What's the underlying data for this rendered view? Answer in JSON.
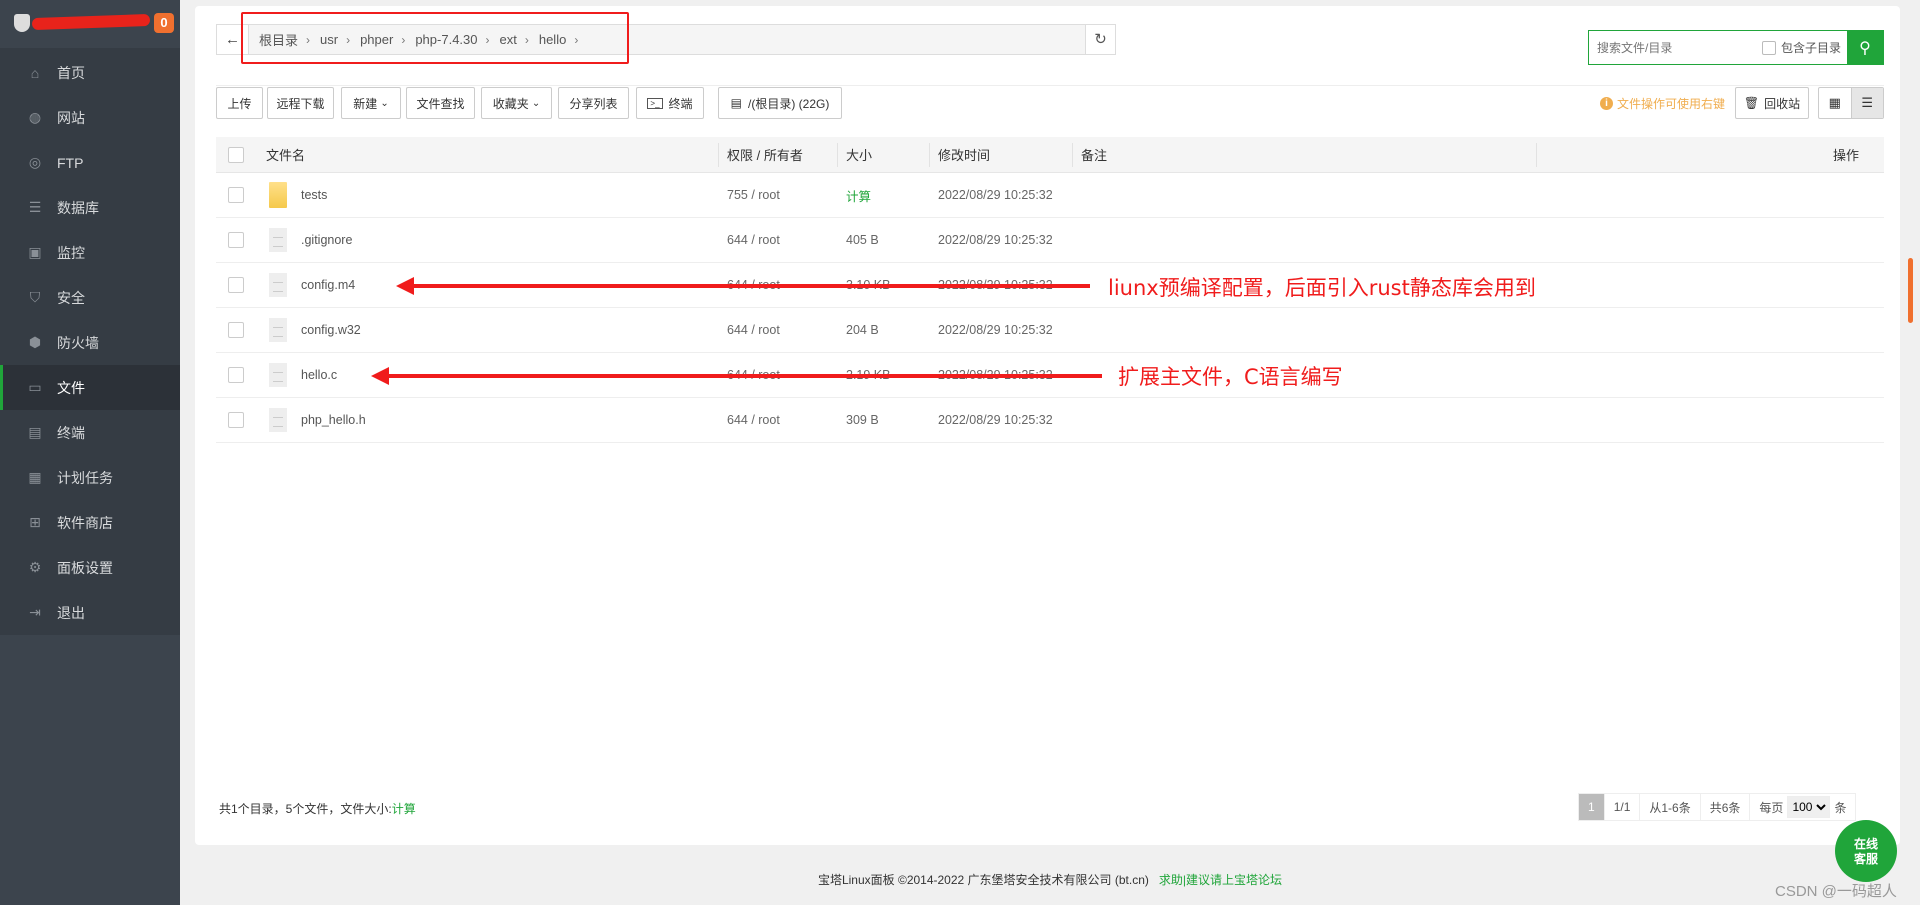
{
  "sidebar": {
    "badge": "0",
    "items": [
      {
        "label": "首页",
        "icon": "home-icon"
      },
      {
        "label": "网站",
        "icon": "globe-icon"
      },
      {
        "label": "FTP",
        "icon": "ftp-icon"
      },
      {
        "label": "数据库",
        "icon": "database-icon"
      },
      {
        "label": "监控",
        "icon": "monitor-icon"
      },
      {
        "label": "安全",
        "icon": "shield-icon"
      },
      {
        "label": "防火墙",
        "icon": "firewall-icon"
      },
      {
        "label": "文件",
        "icon": "folder-icon",
        "active": true
      },
      {
        "label": "终端",
        "icon": "terminal-icon"
      },
      {
        "label": "计划任务",
        "icon": "calendar-icon"
      },
      {
        "label": "软件商店",
        "icon": "apps-icon"
      },
      {
        "label": "面板设置",
        "icon": "gear-icon"
      },
      {
        "label": "退出",
        "icon": "logout-icon"
      }
    ]
  },
  "breadcrumb": [
    "根目录",
    "usr",
    "phper",
    "php-7.4.30",
    "ext",
    "hello"
  ],
  "search": {
    "placeholder": "搜索文件/目录",
    "subdir_label": "包含子目录"
  },
  "toolbar": {
    "upload": "上传",
    "remote_download": "远程下载",
    "new": "新建",
    "find": "文件查找",
    "favorites": "收藏夹",
    "share_list": "分享列表",
    "terminal": "终端",
    "disk": "/(根目录) (22G)",
    "tip": "文件操作可使用右键",
    "recycle": "回收站"
  },
  "table": {
    "headers": {
      "name": "文件名",
      "perm": "权限 / 所有者",
      "size": "大小",
      "mtime": "修改时间",
      "remark": "备注",
      "ops": "操作"
    },
    "rows": [
      {
        "name": "tests",
        "type": "folder",
        "perm": "755 / root",
        "size": "计算",
        "mtime": "2022/08/29 10:25:32"
      },
      {
        "name": ".gitignore",
        "type": "file",
        "perm": "644 / root",
        "size": "405 B",
        "mtime": "2022/08/29 10:25:32"
      },
      {
        "name": "config.m4",
        "type": "file",
        "perm": "644 / root",
        "size": "3.10 KB",
        "mtime": "2022/08/29 10:25:32"
      },
      {
        "name": "config.w32",
        "type": "file",
        "perm": "644 / root",
        "size": "204 B",
        "mtime": "2022/08/29 10:25:32"
      },
      {
        "name": "hello.c",
        "type": "file",
        "perm": "644 / root",
        "size": "2.19 KB",
        "mtime": "2022/08/29 10:25:32"
      },
      {
        "name": "php_hello.h",
        "type": "file",
        "perm": "644 / root",
        "size": "309 B",
        "mtime": "2022/08/29 10:25:32"
      }
    ]
  },
  "annotations": [
    "liunx预编译配置，后面引入rust静态库会用到",
    "扩展主文件，C语言编写"
  ],
  "summary": {
    "text": "共1个目录，5个文件，文件大小:",
    "link": "计算"
  },
  "pager": {
    "current": "1",
    "pages": "1/1",
    "range": "从1-6条",
    "total": "共6条",
    "per_page_label": "每页",
    "per_page": "100",
    "unit": "条"
  },
  "footer": {
    "copyright": "宝塔Linux面板 ©2014-2022 广东堡塔安全技术有限公司 (bt.cn)",
    "help": "求助|建议请上宝塔论坛"
  },
  "chat": {
    "line1": "在线",
    "line2": "客服"
  },
  "watermark": "CSDN @一码超人",
  "colors": {
    "accent": "#20a53a",
    "annotation": "#f01c1c",
    "sidebar": "#3c444d"
  }
}
